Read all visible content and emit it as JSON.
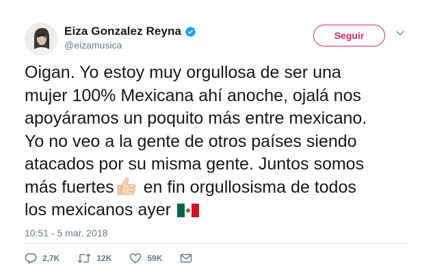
{
  "user": {
    "display_name": "Eiza Gonzalez Reyna",
    "handle": "@eizamusica",
    "verified": true,
    "avatar_icon": "avatar-photo"
  },
  "follow_button": {
    "label": "Seguir",
    "color": "#e0245e"
  },
  "menu": {
    "icon": "chevron-down-icon"
  },
  "tweet": {
    "lines": [
      "Oigan. Yo estoy muy orgullosa de ser una",
      "mujer 100% Mexicana ahí anoche, ojalá nos",
      "apoyáramos un poquito más entre mexicano.",
      "Yo no veo a la gente de otros países siendo",
      "atacados por su misma gente. Juntos somos",
      "más fuertes",
      "en fin orgullosisma de todos",
      "los mexicanos ayer"
    ],
    "emojis": [
      "thumbs-up-icon",
      "mexico-flag-icon"
    ]
  },
  "timestamp": "10:51 - 5 mar. 2018",
  "actions": {
    "reply": {
      "icon": "reply-icon",
      "count": "2,7K"
    },
    "retweet": {
      "icon": "retweet-icon",
      "count": "12K"
    },
    "like": {
      "icon": "heart-icon",
      "count": "59K"
    },
    "message": {
      "icon": "envelope-icon"
    }
  },
  "colors": {
    "text": "#14171a",
    "secondary": "#657786",
    "verified": "#1da1f2",
    "accent": "#e0245e"
  }
}
